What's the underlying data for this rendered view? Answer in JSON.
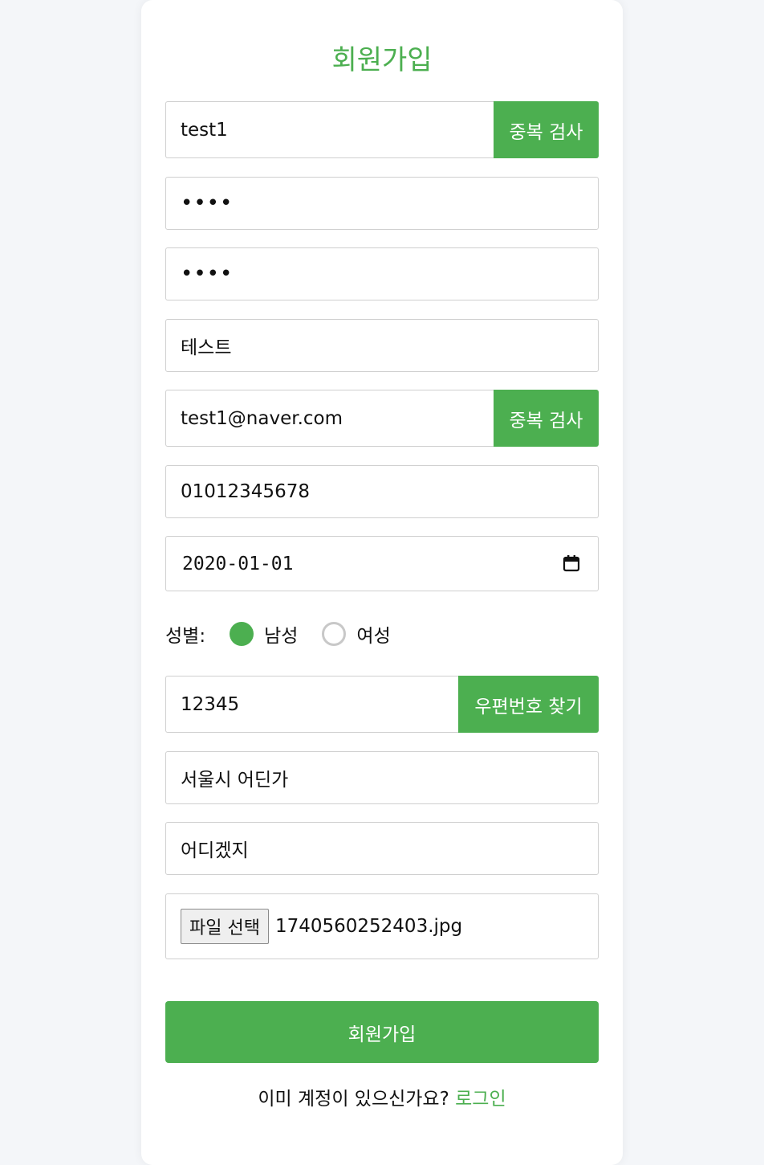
{
  "title": "회원가입",
  "accent_color": "#4caf50",
  "id_field": {
    "value": "test1",
    "button": "중복 검사"
  },
  "password_field": {
    "value": "••••"
  },
  "password_confirm_field": {
    "value": "••••"
  },
  "name_field": {
    "value": "테스트"
  },
  "email_field": {
    "value": "test1@naver.com",
    "button": "중복 검사"
  },
  "phone_field": {
    "value": "01012345678"
  },
  "birth_field": {
    "value": "2020-01-01",
    "icon": "calendar-icon"
  },
  "gender": {
    "label": "성별:",
    "options": [
      {
        "label": "남성",
        "selected": true
      },
      {
        "label": "여성",
        "selected": false
      }
    ]
  },
  "zipcode_field": {
    "value": "12345",
    "button": "우편번호 찾기"
  },
  "address_field": {
    "value": "서울시 어딘가"
  },
  "address_detail_field": {
    "value": "어디겠지"
  },
  "file_field": {
    "button": "파일 선택",
    "filename": "1740560252403.jpg"
  },
  "submit_label": "회원가입",
  "footer": {
    "text": "이미 계정이 있으신가요?",
    "link": "로그인"
  }
}
